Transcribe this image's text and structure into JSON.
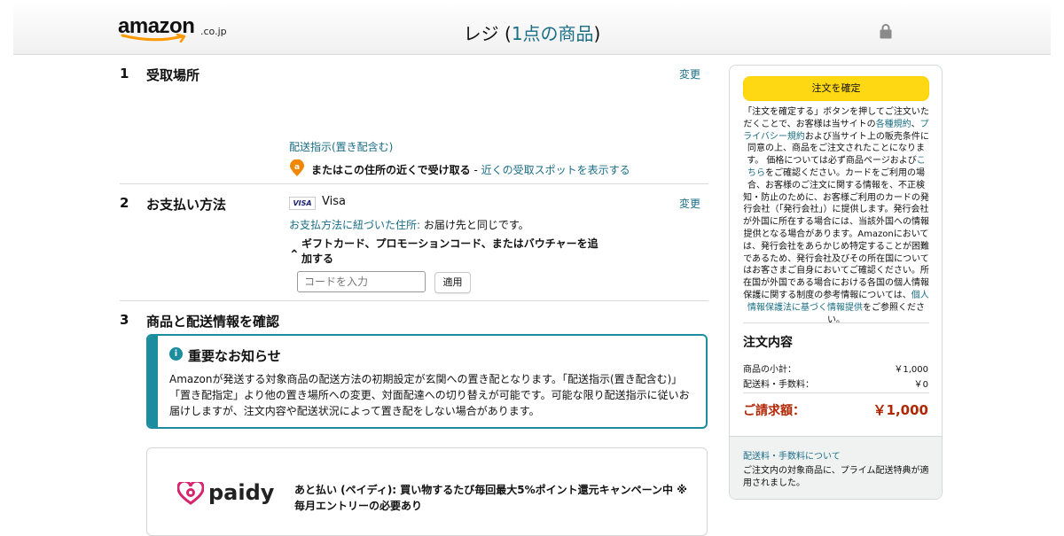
{
  "header": {
    "logo_text": "amazon",
    "logo_suffix": ".co.jp",
    "title_main": "レジ (",
    "title_count": "1点の商品",
    "title_end": ")"
  },
  "section1": {
    "number": "1",
    "title": "受取場所",
    "change": "変更",
    "delivery_instructions": "配送指示(置き配含む)",
    "pickup_text": "またはこの住所の近くで受け取る",
    "pickup_sep": " - ",
    "pickup_link": "近くの受取スポットを表示する"
  },
  "section2": {
    "number": "2",
    "title": "お支払い方法",
    "change": "変更",
    "card_badge": "VISA",
    "card_name": "Visa",
    "billing_label": "お支払方法に紐づいた住所:",
    "billing_value": " お届け先と同じです。",
    "gift_label": "ギフトカード、プロモーションコード、またはバウチャーを追加する",
    "code_placeholder": "コードを入力",
    "apply": "適用"
  },
  "section3": {
    "number": "3",
    "title": "商品と配送情報を確認",
    "notice_title": "重要なお知らせ",
    "notice_body": "Amazonが発送する対象商品の配送方法の初期設定が玄関への置き配となります。「配送指示(置き配含む)」「置き配指定」より他の置き場所への変更、対面配達への切り替えが可能です。可能な限り配送指示に従いお届けしますが、注文内容や配送状況によって置き配をしない場合があります。",
    "paidy_logo": "paidy",
    "paidy_text": "あと払い (ペイディ): 買い物するたび毎回最大5%ポイント還元キャンペーン中 ※毎月エントリーの必要あり"
  },
  "sidebar": {
    "order_button": "注文を確定",
    "legal_1": "「注文を確定する」ボタンを押してご注文いただくことで、お客様は当サイトの",
    "legal_link_1": "各種規約",
    "legal_2": "、",
    "legal_link_2": "プライバシー規約",
    "legal_3": "および当サイト上の販売条件に同意の上、商品をご注文されたことになります。 価格については必ず商品ページおよび",
    "legal_link_3": "こちら",
    "legal_4": "をご確認ください。カードをご利用の場合、お客様のご注文に関する情報を、不正検知・防止のために、お客様ご利用のカードの発行会社（「発行会社」）に提供します。発行会社が外国に所在する場合には、当該外国への情報提供となる場合があります。Amazonにおいては、発行会社をあらかじめ特定することが困難であるため、発行会社及びその所在国についてはお客さまご自身においてご確認ください。所在国が外国である場合における各国の個人情報保護に関する制度の参考情報については、",
    "legal_link_4": "個人情報保護法に基づく情報提供",
    "legal_5": "をご参照ください。",
    "summary_title": "注文内容",
    "subtotal_label": "商品の小計：",
    "subtotal_value": "￥1,000",
    "shipping_label": "配送料・手数料：",
    "shipping_value": "￥0",
    "total_label": "ご請求額：",
    "total_value": "￥1,000",
    "shipping_link": "配送料・手数料について",
    "shipping_note": "ご注文内の対象商品に、プライム配送特典が適用されました。"
  },
  "colors": {
    "link": "#1a6e86",
    "accent_button": "#ffd814",
    "notice_border": "#1b8d9e",
    "total": "#b12704",
    "amazon_smile": "#ff9900"
  },
  "icons": [
    "amazon-smile-icon",
    "lock-icon",
    "pickup-location-icon",
    "chevron-up-icon",
    "info-icon",
    "paidy-logo-icon"
  ]
}
